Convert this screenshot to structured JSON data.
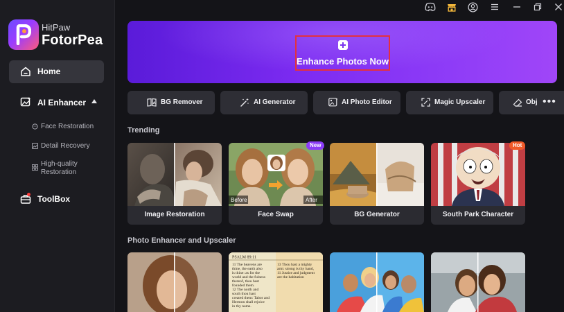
{
  "app": {
    "brand_small": "HitPaw",
    "brand_big": "FotorPea",
    "accent_color": "#8b3cf7",
    "highlight_color": "#e3313f"
  },
  "titlebar": {
    "icons": [
      "discord-icon",
      "shop-icon",
      "account-icon",
      "menu-icon",
      "minimize-icon",
      "restore-icon",
      "close-icon"
    ]
  },
  "sidebar": {
    "home": "Home",
    "ai_enhancer": "AI Enhancer",
    "sub_items": [
      "Face Restoration",
      "Detail Recovery",
      "High-quality Restoration"
    ],
    "toolbox": "ToolBox"
  },
  "banner": {
    "cta": "Enhance Photos Now"
  },
  "tools": [
    "BG Remover",
    "AI Generator",
    "AI Photo Editor",
    "Magic Upscaler",
    "Obj"
  ],
  "trending": {
    "title": "Trending",
    "cards": [
      {
        "label": "Image Restoration"
      },
      {
        "label": "Face Swap",
        "badge": "New",
        "before": "Before",
        "after": "After"
      },
      {
        "label": "BG Generator"
      },
      {
        "label": "South Park Character",
        "badge": "Hot"
      }
    ]
  },
  "enhancer": {
    "title": "Photo Enhancer and Upscaler",
    "psalm_title": "PSALM 89:11",
    "psalm_lines": [
      "11  The heavens are",
      "thine, the earth also",
      "is thine: as for the",
      "world and the fulness",
      "thereof, thou hast",
      "founded them.",
      "12  The north and",
      "south thou hast",
      "created them: Tabor and",
      "Hermon shall rejoice",
      "in thy name.",
      "13  Thou hast a mighty",
      "arm: strong is thy hand,",
      "11  Justice and judgment",
      "are the habitation"
    ]
  }
}
